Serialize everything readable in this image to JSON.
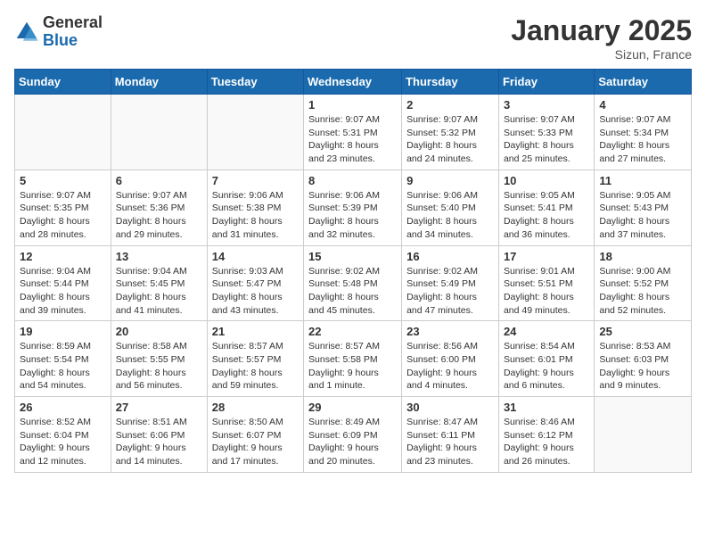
{
  "logo": {
    "general": "General",
    "blue": "Blue"
  },
  "header": {
    "month_year": "January 2025",
    "location": "Sizun, France"
  },
  "weekdays": [
    "Sunday",
    "Monday",
    "Tuesday",
    "Wednesday",
    "Thursday",
    "Friday",
    "Saturday"
  ],
  "weeks": [
    [
      {
        "day": "",
        "info": ""
      },
      {
        "day": "",
        "info": ""
      },
      {
        "day": "",
        "info": ""
      },
      {
        "day": "1",
        "info": "Sunrise: 9:07 AM\nSunset: 5:31 PM\nDaylight: 8 hours and 23 minutes."
      },
      {
        "day": "2",
        "info": "Sunrise: 9:07 AM\nSunset: 5:32 PM\nDaylight: 8 hours and 24 minutes."
      },
      {
        "day": "3",
        "info": "Sunrise: 9:07 AM\nSunset: 5:33 PM\nDaylight: 8 hours and 25 minutes."
      },
      {
        "day": "4",
        "info": "Sunrise: 9:07 AM\nSunset: 5:34 PM\nDaylight: 8 hours and 27 minutes."
      }
    ],
    [
      {
        "day": "5",
        "info": "Sunrise: 9:07 AM\nSunset: 5:35 PM\nDaylight: 8 hours and 28 minutes."
      },
      {
        "day": "6",
        "info": "Sunrise: 9:07 AM\nSunset: 5:36 PM\nDaylight: 8 hours and 29 minutes."
      },
      {
        "day": "7",
        "info": "Sunrise: 9:06 AM\nSunset: 5:38 PM\nDaylight: 8 hours and 31 minutes."
      },
      {
        "day": "8",
        "info": "Sunrise: 9:06 AM\nSunset: 5:39 PM\nDaylight: 8 hours and 32 minutes."
      },
      {
        "day": "9",
        "info": "Sunrise: 9:06 AM\nSunset: 5:40 PM\nDaylight: 8 hours and 34 minutes."
      },
      {
        "day": "10",
        "info": "Sunrise: 9:05 AM\nSunset: 5:41 PM\nDaylight: 8 hours and 36 minutes."
      },
      {
        "day": "11",
        "info": "Sunrise: 9:05 AM\nSunset: 5:43 PM\nDaylight: 8 hours and 37 minutes."
      }
    ],
    [
      {
        "day": "12",
        "info": "Sunrise: 9:04 AM\nSunset: 5:44 PM\nDaylight: 8 hours and 39 minutes."
      },
      {
        "day": "13",
        "info": "Sunrise: 9:04 AM\nSunset: 5:45 PM\nDaylight: 8 hours and 41 minutes."
      },
      {
        "day": "14",
        "info": "Sunrise: 9:03 AM\nSunset: 5:47 PM\nDaylight: 8 hours and 43 minutes."
      },
      {
        "day": "15",
        "info": "Sunrise: 9:02 AM\nSunset: 5:48 PM\nDaylight: 8 hours and 45 minutes."
      },
      {
        "day": "16",
        "info": "Sunrise: 9:02 AM\nSunset: 5:49 PM\nDaylight: 8 hours and 47 minutes."
      },
      {
        "day": "17",
        "info": "Sunrise: 9:01 AM\nSunset: 5:51 PM\nDaylight: 8 hours and 49 minutes."
      },
      {
        "day": "18",
        "info": "Sunrise: 9:00 AM\nSunset: 5:52 PM\nDaylight: 8 hours and 52 minutes."
      }
    ],
    [
      {
        "day": "19",
        "info": "Sunrise: 8:59 AM\nSunset: 5:54 PM\nDaylight: 8 hours and 54 minutes."
      },
      {
        "day": "20",
        "info": "Sunrise: 8:58 AM\nSunset: 5:55 PM\nDaylight: 8 hours and 56 minutes."
      },
      {
        "day": "21",
        "info": "Sunrise: 8:57 AM\nSunset: 5:57 PM\nDaylight: 8 hours and 59 minutes."
      },
      {
        "day": "22",
        "info": "Sunrise: 8:57 AM\nSunset: 5:58 PM\nDaylight: 9 hours and 1 minute."
      },
      {
        "day": "23",
        "info": "Sunrise: 8:56 AM\nSunset: 6:00 PM\nDaylight: 9 hours and 4 minutes."
      },
      {
        "day": "24",
        "info": "Sunrise: 8:54 AM\nSunset: 6:01 PM\nDaylight: 9 hours and 6 minutes."
      },
      {
        "day": "25",
        "info": "Sunrise: 8:53 AM\nSunset: 6:03 PM\nDaylight: 9 hours and 9 minutes."
      }
    ],
    [
      {
        "day": "26",
        "info": "Sunrise: 8:52 AM\nSunset: 6:04 PM\nDaylight: 9 hours and 12 minutes."
      },
      {
        "day": "27",
        "info": "Sunrise: 8:51 AM\nSunset: 6:06 PM\nDaylight: 9 hours and 14 minutes."
      },
      {
        "day": "28",
        "info": "Sunrise: 8:50 AM\nSunset: 6:07 PM\nDaylight: 9 hours and 17 minutes."
      },
      {
        "day": "29",
        "info": "Sunrise: 8:49 AM\nSunset: 6:09 PM\nDaylight: 9 hours and 20 minutes."
      },
      {
        "day": "30",
        "info": "Sunrise: 8:47 AM\nSunset: 6:11 PM\nDaylight: 9 hours and 23 minutes."
      },
      {
        "day": "31",
        "info": "Sunrise: 8:46 AM\nSunset: 6:12 PM\nDaylight: 9 hours and 26 minutes."
      },
      {
        "day": "",
        "info": ""
      }
    ]
  ]
}
